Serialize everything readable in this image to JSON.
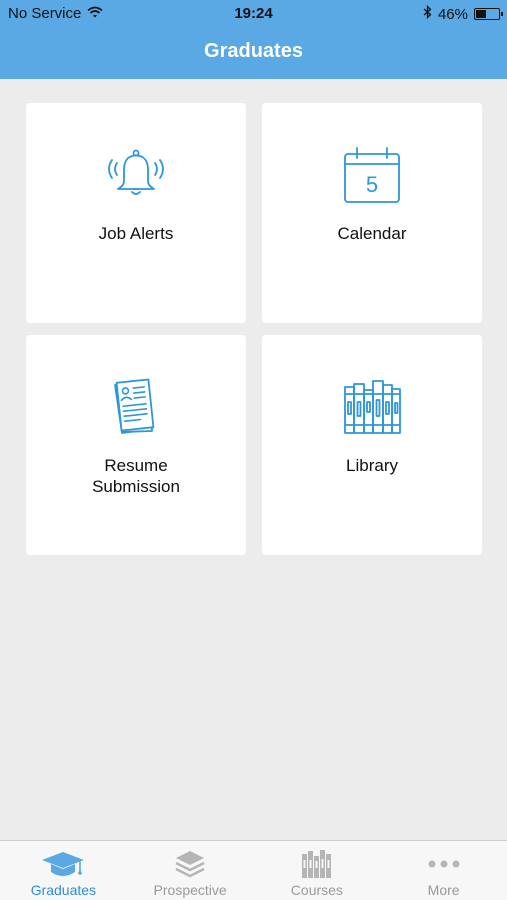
{
  "status_bar": {
    "carrier": "No Service",
    "time": "19:24",
    "battery": "46%",
    "battery_level": 0.46
  },
  "header": {
    "title": "Graduates"
  },
  "tiles": [
    {
      "label": "Job Alerts",
      "icon": "bell-icon"
    },
    {
      "label": "Calendar",
      "icon": "calendar-icon",
      "icon_text": "5"
    },
    {
      "label": "Resume\nSubmission",
      "icon": "resume-icon"
    },
    {
      "label": "Library",
      "icon": "library-icon"
    }
  ],
  "tabbar": {
    "items": [
      {
        "label": "Graduates",
        "icon": "graduation-cap-icon",
        "active": true
      },
      {
        "label": "Prospective",
        "icon": "layers-icon",
        "active": false
      },
      {
        "label": "Courses",
        "icon": "books-icon",
        "active": false
      },
      {
        "label": "More",
        "icon": "more-dots-icon",
        "active": false
      }
    ]
  },
  "colors": {
    "accent": "#5aa9e4",
    "icon_blue": "#2d97d8",
    "tab_active": "#2d8fd8",
    "tab_inactive": "#9a9a9a",
    "background": "#ececec"
  }
}
